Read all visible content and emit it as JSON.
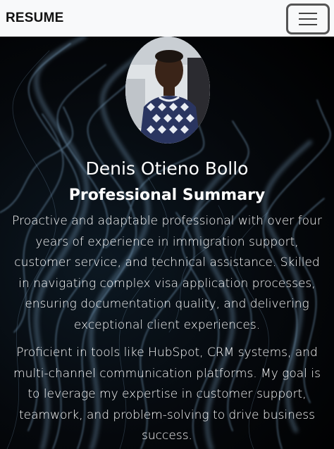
{
  "navbar": {
    "brand": "RESUME",
    "menu_icon": "hamburger-menu-icon"
  },
  "profile": {
    "name": "Denis Otieno Bollo",
    "section_title": "Professional Summary",
    "paragraphs": [
      "Proactive and adaptable professional with over four years of experience in immigration support, customer service, and technical assistance. Skilled in navigating complex visa application processes, ensuring documentation quality, and delivering exceptional client experiences.",
      "Proficient in tools like HubSpot, CRM systems, and multi-channel communication platforms. My goal is to leverage my expertise in customer support, teamwork, and problem-solving to drive business success."
    ]
  },
  "colors": {
    "navbar_bg": "#f8f9fa",
    "hero_bg": "#000000",
    "text": "#ffffff",
    "smoke": "#8ab4d6"
  }
}
